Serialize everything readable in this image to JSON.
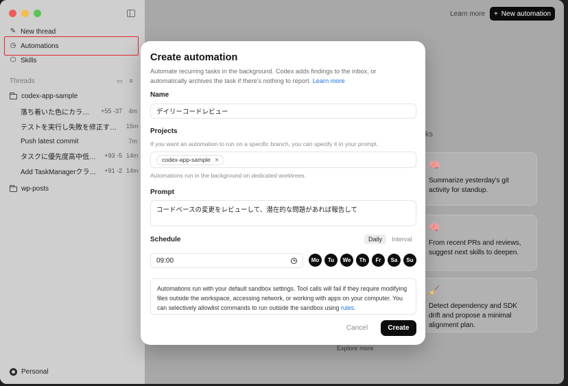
{
  "sidebar": {
    "nav": [
      {
        "label": "New thread",
        "icon": "edit-icon"
      },
      {
        "label": "Automations",
        "icon": "clock-icon"
      },
      {
        "label": "Skills",
        "icon": "cube-icon"
      }
    ],
    "threads_label": "Threads",
    "projects": [
      {
        "name": "codex-app-sample",
        "threads": [
          {
            "title": "落ち着いた色にカラ…",
            "diff": "+55 -37",
            "time": "4m"
          },
          {
            "title": "テストを実行し失敗を修正する調…",
            "diff": "",
            "time": "15m"
          },
          {
            "title": "Push latest commit",
            "diff": "",
            "time": "7m"
          },
          {
            "title": "タスクに優先度高中低設…",
            "diff": "+93 -5",
            "time": "14m"
          },
          {
            "title": "Add TaskManagerクラス…",
            "diff": "+91 -2",
            "time": "14m"
          }
        ]
      },
      {
        "name": "wp-posts",
        "threads": []
      }
    ],
    "account": "Personal"
  },
  "main": {
    "learn_more": "Learn more",
    "new_automation": "New automation",
    "tasks_label": "ks",
    "suggestions": [
      {
        "emoji": "🧠",
        "text": "Summarize yesterday's git activity for standup."
      },
      {
        "emoji": "🧠",
        "text": "From recent PRs and reviews, suggest next skills to deepen."
      },
      {
        "emoji": "🧹",
        "text": "Detect dependency and SDK drift and propose a minimal alignment plan."
      }
    ],
    "explore_more": "Explore more"
  },
  "modal": {
    "title": "Create automation",
    "description": "Automate recurring tasks in the background. Codex adds findings to the inbox, or automatically archives the task if there's nothing to report.",
    "description_link": "Learn more",
    "name_label": "Name",
    "name_value": "デイリーコードレビュー",
    "projects_label": "Projects",
    "projects_hint": "If you want an automation to run on a specific branch, you can specify it in your prompt.",
    "project_chip": "codex-app-sample",
    "projects_note": "Automations run in the background on dedicated worktrees.",
    "prompt_label": "Prompt",
    "prompt_value": "コードベースの変更をレビューして、潜在的な問題があれば報告して",
    "schedule_label": "Schedule",
    "schedule_modes": [
      "Daily",
      "Interval"
    ],
    "time_value": "09:00",
    "days": [
      "Mo",
      "Tu",
      "We",
      "Th",
      "Fr",
      "Sa",
      "Su"
    ],
    "notice": "Automations run with your default sandbox settings. Tool calls will fail if they require modifying files outside the workspace, accessing network, or working with apps on your computer. You can selectively allowlist commands to run outside the sandbox using",
    "notice_link": "rules",
    "cancel": "Cancel",
    "create": "Create"
  },
  "colors": {
    "accent_link": "#1a73d9",
    "highlight": "#e2242d",
    "button_dark": "#0d0d0d"
  }
}
